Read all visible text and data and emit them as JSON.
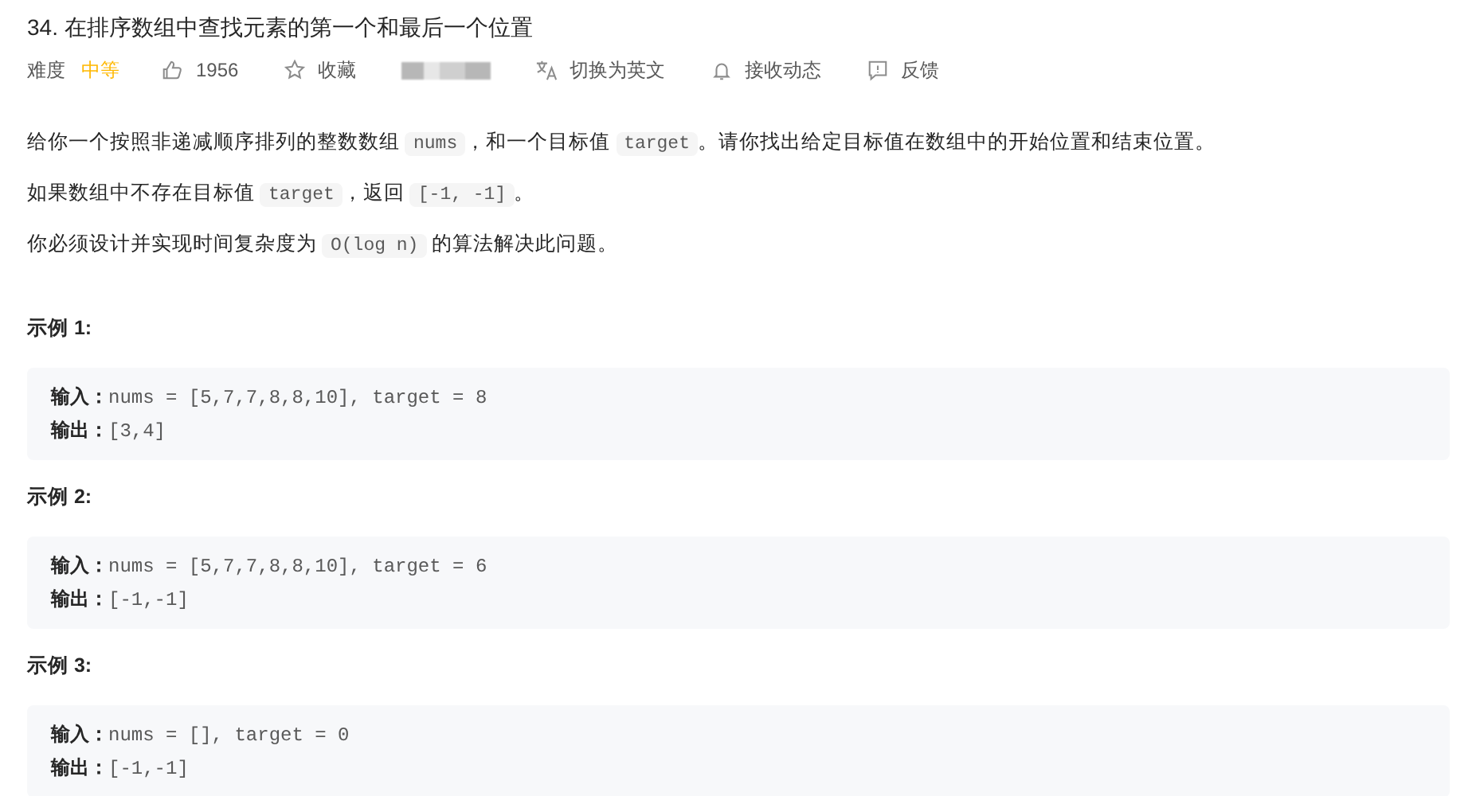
{
  "title": "34. 在排序数组中查找元素的第一个和最后一个位置",
  "meta": [
    {
      "kind": "difficulty",
      "label": "难度",
      "value": "中等"
    },
    {
      "kind": "like",
      "label": "1956"
    },
    {
      "kind": "star",
      "label": "收藏"
    },
    {
      "kind": "redacted"
    },
    {
      "kind": "translate",
      "label": "切换为英文"
    },
    {
      "kind": "bell",
      "label": "接收动态"
    },
    {
      "kind": "feedback",
      "label": "反馈"
    }
  ],
  "paragraphs": [
    [
      {
        "kind": "text",
        "text": "给你一个按照非递减顺序排列的整数数组 "
      },
      {
        "kind": "code",
        "text": "nums"
      },
      {
        "kind": "text",
        "text": "，和一个目标值 "
      },
      {
        "kind": "code",
        "text": "target"
      },
      {
        "kind": "text",
        "text": "。请你找出给定目标值在数组中的开始位置和结束位置。"
      }
    ],
    [
      {
        "kind": "text",
        "text": "如果数组中不存在目标值 "
      },
      {
        "kind": "code",
        "text": "target"
      },
      {
        "kind": "text",
        "text": "，返回 "
      },
      {
        "kind": "code",
        "text": "[-1, -1]"
      },
      {
        "kind": "text",
        "text": "。"
      }
    ],
    [
      {
        "kind": "text",
        "text": "你必须设计并实现时间复杂度为 "
      },
      {
        "kind": "code",
        "text": "O(log n)"
      },
      {
        "kind": "text",
        "text": " 的算法解决此问题。"
      }
    ]
  ],
  "examples": [
    {
      "heading": "示例 1:",
      "lines": [
        {
          "label": "输入：",
          "value": "nums = [5,7,7,8,8,10], target = 8"
        },
        {
          "label": "输出：",
          "value": "[3,4]"
        }
      ]
    },
    {
      "heading": "示例 2:",
      "lines": [
        {
          "label": "输入：",
          "value": "nums = [5,7,7,8,8,10], target = 6"
        },
        {
          "label": "输出：",
          "value": "[-1,-1]"
        }
      ]
    },
    {
      "heading": "示例 3:",
      "lines": [
        {
          "label": "输入：",
          "value": "nums = [], target = 0"
        },
        {
          "label": "输出：",
          "value": "[-1,-1]"
        }
      ]
    }
  ]
}
